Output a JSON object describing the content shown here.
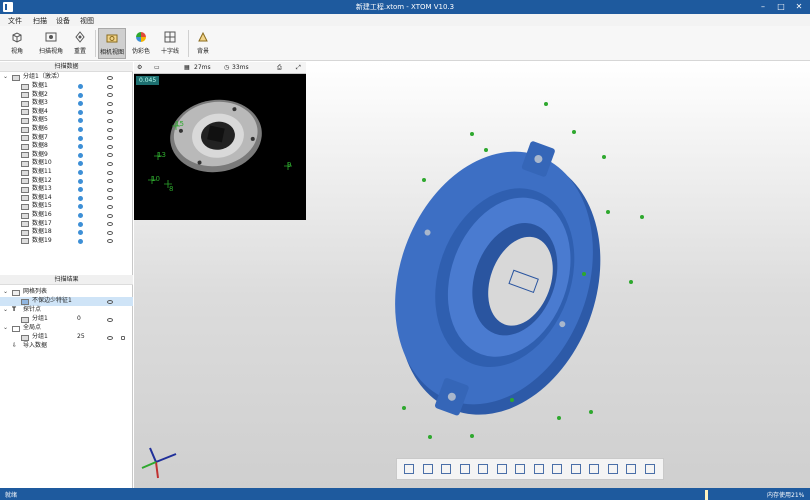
{
  "window": {
    "title": "新建工程.xtom - XTOM V10.3"
  },
  "menu": [
    "文件",
    "扫描",
    "设备",
    "视图"
  ],
  "ribbon": {
    "buttons": [
      "视角",
      "扫描视角",
      "重置",
      "相机视图",
      "伪彩色",
      "十字线",
      "背景"
    ]
  },
  "scan_data": {
    "title": "扫描数据",
    "group": "分组1（激活）",
    "items": [
      "数据1",
      "数据2",
      "数据3",
      "数据4",
      "数据5",
      "数据6",
      "数据7",
      "数据8",
      "数据9",
      "数据10",
      "数据11",
      "数据12",
      "数据13",
      "数据14",
      "数据15",
      "数据16",
      "数据17",
      "数据18",
      "数据19"
    ]
  },
  "scan_results": {
    "title": "扫描结果",
    "mesh_list": "网格列表",
    "mesh_item": "不保边少特征1",
    "probe": "探针点",
    "probe_group": "分组1",
    "probe_count": "0",
    "global": "全局点",
    "global_group": "分组1",
    "global_count": "25",
    "import": "导入数据"
  },
  "viewport": {
    "toolbar": {
      "t1": "27ms",
      "t2": "33ms"
    },
    "camera_value": "0.045",
    "camera_labels": [
      "15",
      "13",
      "10",
      "8",
      "9"
    ]
  },
  "status": {
    "left": "就绪",
    "right": "内存使用21%"
  },
  "colors": {
    "accent": "#1e5a9e",
    "part": "#3d6fc4",
    "marker": "#2ea82e"
  }
}
